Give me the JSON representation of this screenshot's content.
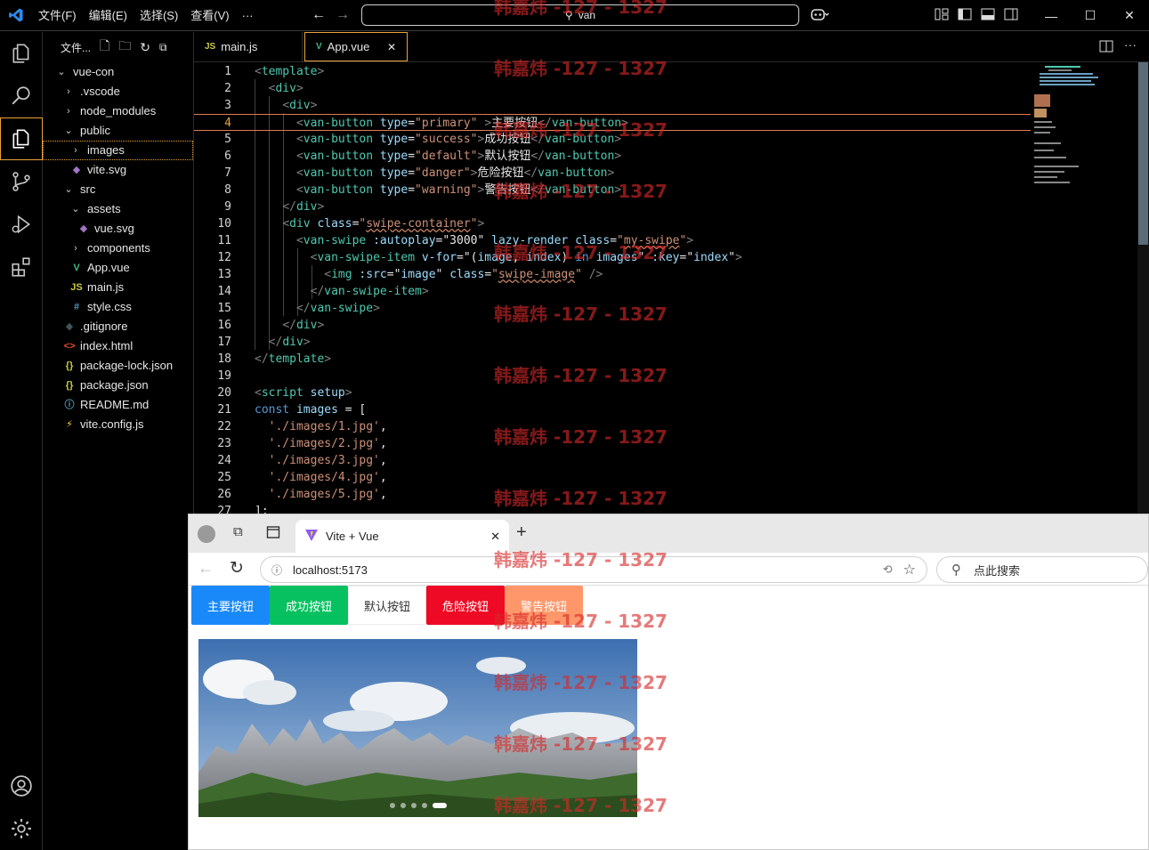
{
  "titlebar": {
    "menus": [
      "文件(F)",
      "编辑(E)",
      "选择(S)",
      "查看(V)",
      "···"
    ],
    "search_value": "van"
  },
  "sidebar": {
    "title": "文件...",
    "tree": [
      {
        "label": "vue-con",
        "indent": 0,
        "kind": "folder-open",
        "icon": ""
      },
      {
        "label": ".vscode",
        "indent": 1,
        "kind": "folder",
        "icon": ""
      },
      {
        "label": "node_modules",
        "indent": 1,
        "kind": "folder",
        "icon": ""
      },
      {
        "label": "public",
        "indent": 1,
        "kind": "folder-open",
        "icon": ""
      },
      {
        "label": "images",
        "indent": 2,
        "kind": "folder",
        "icon": "",
        "selected": true
      },
      {
        "label": "vite.svg",
        "indent": 2,
        "kind": "file",
        "icon": "svg"
      },
      {
        "label": "src",
        "indent": 1,
        "kind": "folder-open",
        "icon": ""
      },
      {
        "label": "assets",
        "indent": 2,
        "kind": "folder-open",
        "icon": ""
      },
      {
        "label": "vue.svg",
        "indent": 3,
        "kind": "file",
        "icon": "svg"
      },
      {
        "label": "components",
        "indent": 2,
        "kind": "folder",
        "icon": ""
      },
      {
        "label": "App.vue",
        "indent": 2,
        "kind": "file",
        "icon": "vue"
      },
      {
        "label": "main.js",
        "indent": 2,
        "kind": "file",
        "icon": "js"
      },
      {
        "label": "style.css",
        "indent": 2,
        "kind": "file",
        "icon": "css"
      },
      {
        "label": ".gitignore",
        "indent": 1,
        "kind": "file",
        "icon": "git"
      },
      {
        "label": "index.html",
        "indent": 1,
        "kind": "file",
        "icon": "html"
      },
      {
        "label": "package-lock.json",
        "indent": 1,
        "kind": "file",
        "icon": "json"
      },
      {
        "label": "package.json",
        "indent": 1,
        "kind": "file",
        "icon": "json"
      },
      {
        "label": "README.md",
        "indent": 1,
        "kind": "file",
        "icon": "info"
      },
      {
        "label": "vite.config.js",
        "indent": 1,
        "kind": "file",
        "icon": "vite"
      }
    ]
  },
  "tabs": [
    {
      "label": "main.js",
      "icon": "JS",
      "active": false
    },
    {
      "label": "App.vue",
      "icon": "V",
      "active": true
    }
  ],
  "editor": {
    "current_line": 4,
    "lines": [
      [
        [
          "t-br",
          "<"
        ],
        [
          "t-tag",
          "template"
        ],
        [
          "t-br",
          ">"
        ]
      ],
      [
        [
          "",
          "  "
        ],
        [
          "t-br",
          "<"
        ],
        [
          "t-tag",
          "div"
        ],
        [
          "t-br",
          ">"
        ]
      ],
      [
        [
          "",
          "    "
        ],
        [
          "t-br",
          "<"
        ],
        [
          "t-tag",
          "div"
        ],
        [
          "t-br",
          ">"
        ]
      ],
      [
        [
          "",
          "      "
        ],
        [
          "t-br",
          "<"
        ],
        [
          "t-tag",
          "van-button"
        ],
        [
          "",
          " "
        ],
        [
          "t-attr",
          "type"
        ],
        [
          "t-txt",
          "="
        ],
        [
          "t-str",
          "\"primary\""
        ],
        [
          "",
          " "
        ],
        [
          "t-br",
          ">"
        ],
        [
          "t-txt",
          "主要按钮"
        ],
        [
          "t-br",
          "</"
        ],
        [
          "t-tag",
          "van-button"
        ],
        [
          "t-br",
          ">"
        ]
      ],
      [
        [
          "",
          "      "
        ],
        [
          "t-br",
          "<"
        ],
        [
          "t-tag",
          "van-button"
        ],
        [
          "",
          " "
        ],
        [
          "t-attr",
          "type"
        ],
        [
          "t-txt",
          "="
        ],
        [
          "t-str",
          "\"success\""
        ],
        [
          "t-br",
          ">"
        ],
        [
          "t-txt",
          "成功按钮"
        ],
        [
          "t-br",
          "</"
        ],
        [
          "t-tag",
          "van-button"
        ],
        [
          "t-br",
          ">"
        ]
      ],
      [
        [
          "",
          "      "
        ],
        [
          "t-br",
          "<"
        ],
        [
          "t-tag",
          "van-button"
        ],
        [
          "",
          " "
        ],
        [
          "t-attr",
          "type"
        ],
        [
          "t-txt",
          "="
        ],
        [
          "t-str",
          "\"default\""
        ],
        [
          "t-br",
          ">"
        ],
        [
          "t-txt",
          "默认按钮"
        ],
        [
          "t-br",
          "</"
        ],
        [
          "t-tag",
          "van-button"
        ],
        [
          "t-br",
          ">"
        ]
      ],
      [
        [
          "",
          "      "
        ],
        [
          "t-br",
          "<"
        ],
        [
          "t-tag",
          "van-button"
        ],
        [
          "",
          " "
        ],
        [
          "t-attr",
          "type"
        ],
        [
          "t-txt",
          "="
        ],
        [
          "t-str",
          "\"danger\""
        ],
        [
          "t-br",
          ">"
        ],
        [
          "t-txt",
          "危险按钮"
        ],
        [
          "t-br",
          "</"
        ],
        [
          "t-tag",
          "van-button"
        ],
        [
          "t-br",
          ">"
        ]
      ],
      [
        [
          "",
          "      "
        ],
        [
          "t-br",
          "<"
        ],
        [
          "t-tag",
          "van-button"
        ],
        [
          "",
          " "
        ],
        [
          "t-attr",
          "type"
        ],
        [
          "t-txt",
          "="
        ],
        [
          "t-str",
          "\"warning\""
        ],
        [
          "t-br",
          ">"
        ],
        [
          "t-txt",
          "警告按钮"
        ],
        [
          "t-br",
          "</"
        ],
        [
          "t-tag",
          "van-button"
        ],
        [
          "t-br",
          ">"
        ]
      ],
      [
        [
          "",
          "    "
        ],
        [
          "t-br",
          "</"
        ],
        [
          "t-tag",
          "div"
        ],
        [
          "t-br",
          ">"
        ]
      ],
      [
        [
          "",
          "    "
        ],
        [
          "t-br",
          "<"
        ],
        [
          "t-tag",
          "div"
        ],
        [
          "",
          " "
        ],
        [
          "t-attr",
          "class"
        ],
        [
          "t-txt",
          "="
        ],
        [
          "t-str",
          "\""
        ],
        [
          "t-str t-sq",
          "swipe-container"
        ],
        [
          "t-str",
          "\""
        ],
        [
          "t-br",
          ">"
        ]
      ],
      [
        [
          "",
          "      "
        ],
        [
          "t-br",
          "<"
        ],
        [
          "t-tag",
          "van-swipe"
        ],
        [
          "",
          " "
        ],
        [
          "t-attr",
          ":autoplay"
        ],
        [
          "t-txt",
          "="
        ],
        [
          "t-txt",
          "\"3000\""
        ],
        [
          "",
          " "
        ],
        [
          "t-attr",
          "lazy-render"
        ],
        [
          "",
          " "
        ],
        [
          "t-attr",
          "class"
        ],
        [
          "t-txt",
          "="
        ],
        [
          "t-str",
          "\""
        ],
        [
          "t-str t-sq",
          "my-swipe"
        ],
        [
          "t-str",
          "\""
        ],
        [
          "t-br",
          ">"
        ]
      ],
      [
        [
          "",
          "        "
        ],
        [
          "t-br",
          "<"
        ],
        [
          "t-tag",
          "van-swipe-item"
        ],
        [
          "",
          " "
        ],
        [
          "t-attr",
          "v-for"
        ],
        [
          "t-txt",
          "="
        ],
        [
          "t-txt",
          "\"("
        ],
        [
          "t-attr",
          "image"
        ],
        [
          "t-txt",
          ", "
        ],
        [
          "t-attr",
          "index"
        ],
        [
          "t-txt",
          ") "
        ],
        [
          "t-kw",
          "in"
        ],
        [
          "",
          " "
        ],
        [
          "t-attr",
          "images"
        ],
        [
          "t-txt",
          "\""
        ],
        [
          "",
          " "
        ],
        [
          "t-attr",
          ":key"
        ],
        [
          "t-txt",
          "="
        ],
        [
          "t-txt",
          "\""
        ],
        [
          "t-attr",
          "index"
        ],
        [
          "t-txt",
          "\""
        ],
        [
          "t-br",
          ">"
        ]
      ],
      [
        [
          "",
          "          "
        ],
        [
          "t-br",
          "<"
        ],
        [
          "t-tag",
          "img"
        ],
        [
          "",
          " "
        ],
        [
          "t-attr",
          ":src"
        ],
        [
          "t-txt",
          "="
        ],
        [
          "t-txt",
          "\""
        ],
        [
          "t-attr",
          "image"
        ],
        [
          "t-txt",
          "\""
        ],
        [
          "",
          " "
        ],
        [
          "t-attr",
          "class"
        ],
        [
          "t-txt",
          "="
        ],
        [
          "t-str",
          "\""
        ],
        [
          "t-str t-sq",
          "swipe-image"
        ],
        [
          "t-str",
          "\""
        ],
        [
          "",
          " "
        ],
        [
          "t-br",
          "/>"
        ]
      ],
      [
        [
          "",
          "        "
        ],
        [
          "t-br",
          "</"
        ],
        [
          "t-tag",
          "van-swipe-item"
        ],
        [
          "t-br",
          ">"
        ]
      ],
      [
        [
          "",
          "      "
        ],
        [
          "t-br",
          "</"
        ],
        [
          "t-tag",
          "van-swipe"
        ],
        [
          "t-br",
          ">"
        ]
      ],
      [
        [
          "",
          "    "
        ],
        [
          "t-br",
          "</"
        ],
        [
          "t-tag",
          "div"
        ],
        [
          "t-br",
          ">"
        ]
      ],
      [
        [
          "",
          "  "
        ],
        [
          "t-br",
          "</"
        ],
        [
          "t-tag",
          "div"
        ],
        [
          "t-br",
          ">"
        ]
      ],
      [
        [
          "t-br",
          "</"
        ],
        [
          "t-tag",
          "template"
        ],
        [
          "t-br",
          ">"
        ]
      ],
      [],
      [
        [
          "t-br",
          "<"
        ],
        [
          "t-tag",
          "script"
        ],
        [
          "",
          " "
        ],
        [
          "t-attr",
          "setup"
        ],
        [
          "t-br",
          ">"
        ]
      ],
      [
        [
          "t-kw",
          "const"
        ],
        [
          "",
          " "
        ],
        [
          "t-attr",
          "images"
        ],
        [
          "",
          " "
        ],
        [
          "t-txt",
          "="
        ],
        [
          "",
          " "
        ],
        [
          "t-txt",
          "["
        ]
      ],
      [
        [
          "",
          "  "
        ],
        [
          "t-str",
          "'./images/1.jpg'"
        ],
        [
          "t-txt",
          ","
        ]
      ],
      [
        [
          "",
          "  "
        ],
        [
          "t-str",
          "'./images/2.jpg'"
        ],
        [
          "t-txt",
          ","
        ]
      ],
      [
        [
          "",
          "  "
        ],
        [
          "t-str",
          "'./images/3.jpg'"
        ],
        [
          "t-txt",
          ","
        ]
      ],
      [
        [
          "",
          "  "
        ],
        [
          "t-str",
          "'./images/4.jpg'"
        ],
        [
          "t-txt",
          ","
        ]
      ],
      [
        [
          "",
          "  "
        ],
        [
          "t-str",
          "'./images/5.jpg'"
        ],
        [
          "t-txt",
          ","
        ]
      ],
      [
        [
          "t-txt",
          "];"
        ]
      ]
    ]
  },
  "browser": {
    "tab_title": "Vite + Vue",
    "url": "localhost:5173",
    "search_placeholder": "点此搜索",
    "buttons": [
      {
        "label": "主要按钮",
        "bg": "#1989fa",
        "fg": "#ffffff",
        "border": "#1989fa"
      },
      {
        "label": "成功按钮",
        "bg": "#07c160",
        "fg": "#ffffff",
        "border": "#07c160"
      },
      {
        "label": "默认按钮",
        "bg": "#ffffff",
        "fg": "#323233",
        "border": "#ebedf0"
      },
      {
        "label": "危险按钮",
        "bg": "#ee0a24",
        "fg": "#ffffff",
        "border": "#ee0a24"
      },
      {
        "label": "警告按钮",
        "bg": "#ff976a",
        "fg": "#ffffff",
        "border": "#ff976a"
      }
    ],
    "swipe": {
      "count": 5,
      "active": 4
    }
  },
  "watermark": {
    "text": "韩嘉炜 -127 - 1327",
    "rows": 14
  }
}
